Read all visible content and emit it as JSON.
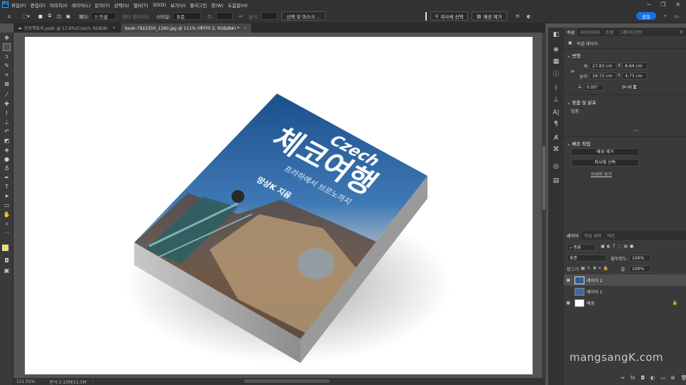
{
  "menu": {
    "app_icon": "Ps",
    "items": [
      "파일(F)",
      "편집(E)",
      "이미지(I)",
      "레이어(L)",
      "문자(Y)",
      "선택(S)",
      "필터(T)",
      "3D(D)",
      "보기(V)",
      "플러그인",
      "창(W)",
      "도움말(H)"
    ]
  },
  "options": {
    "feather_label": "페더:",
    "feather_value": "0 픽셀",
    "antialias": "앤티 앨리어스",
    "style_label": "스타일:",
    "style_value": "표준",
    "width_label": "폭:",
    "height_label": "높이:",
    "select_mask": "선택 및 마스크 ...",
    "select_subject": "피사체 선택",
    "remove_bg": "배경 제거",
    "share": "공유"
  },
  "tabs": [
    {
      "label": "진자책표지.psdc @ 17.8%(Czech, RGB/8)",
      "close": "×"
    },
    {
      "label": "book-7922350_1280.jpg @ 111% (레이어 2, RGB/8#) *",
      "close": "×"
    }
  ],
  "book": {
    "czech": "Czech",
    "title": "체코여행",
    "subtitle": "프라하에서 브르노까지",
    "author": "망상K 지음"
  },
  "status": {
    "zoom": "111.01%",
    "doc": "문서:3.13M/11.5M"
  },
  "panel": {
    "tabs": [
      "속성",
      "라이브러리",
      "조정",
      "그레이디언트"
    ],
    "layer_type": "픽셀 레이어",
    "transform_title": "변형",
    "w_label": "폭",
    "w_value": "27.83 cm",
    "x_label": "X",
    "x_value": "8.64 cm",
    "h_label": "높이",
    "h_value": "19.72 cm",
    "y_label": "Y",
    "y_value": "4.73 cm",
    "angle_value": "0.00°",
    "align_title": "맞춤 및 분포",
    "align_label": "맞춤 :",
    "quick_title": "빠른 작업",
    "remove_bg": "배경 제거",
    "select_subject": "피사체 선택",
    "more": "자세히 보기",
    "layers_tabs": [
      "레이어",
      "작업 내역",
      "액션"
    ],
    "filter_kind": "종류",
    "blend_mode": "표준",
    "opacity_label": "불투명도:",
    "opacity_value": "100%",
    "lock_label": "잠그기:",
    "fill_label": "칠:",
    "fill_value": "100%",
    "layers": [
      {
        "name": "레이어 2",
        "visible": true,
        "selected": true
      },
      {
        "name": "레이어 1",
        "visible": false,
        "selected": false
      },
      {
        "name": "배경",
        "visible": true,
        "selected": false
      }
    ]
  },
  "watermark": "mangsangK.com",
  "colors": {
    "accent": "#1473e6",
    "foreground_swatch": "#f3e33a",
    "background_swatch": "#000000",
    "cover_blue": "#1d5e9e"
  }
}
